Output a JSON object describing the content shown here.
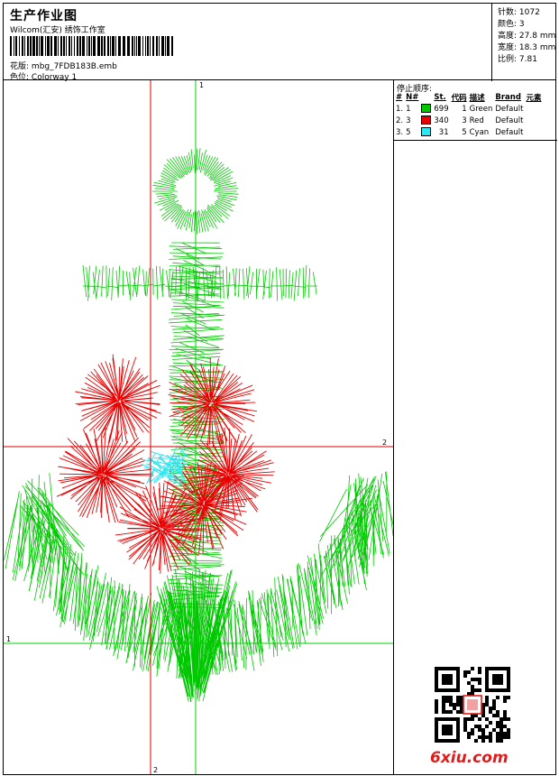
{
  "header": {
    "title": "生产作业图",
    "company": "Wilcom(汇安) 绣饰工作室",
    "design_label": "花版:",
    "design_value": "mbg_7FDB183B.emb",
    "colorway_label": "色位:",
    "colorway_value": "Colorway 1"
  },
  "specs": [
    {
      "label": "针数:",
      "value": "1072"
    },
    {
      "label": "颜色:",
      "value": "3"
    },
    {
      "label": "高度:",
      "value": "27.8 mm"
    },
    {
      "label": "宽度:",
      "value": "18.3 mm"
    },
    {
      "label": "比例:",
      "value": "7.81"
    }
  ],
  "stop_sequence": {
    "title": "停止顺序:",
    "columns": [
      "#",
      "N#",
      "St.",
      "代码",
      "描述",
      "Brand",
      "元素"
    ],
    "rows": [
      {
        "index": "1.",
        "needle": "1",
        "stitches": "699",
        "code": "1",
        "desc": "Green",
        "brand": "Default",
        "color": "#00c800"
      },
      {
        "index": "2.",
        "needle": "3",
        "stitches": "340",
        "code": "3",
        "desc": "Red",
        "brand": "Default",
        "color": "#e60000"
      },
      {
        "index": "3.",
        "needle": "5",
        "stitches": "31",
        "code": "5",
        "desc": "Cyan",
        "brand": "Default",
        "color": "#2ee6f0"
      }
    ]
  },
  "guides": {
    "v1_label": "1",
    "v2_label": "2",
    "h1_label": "1",
    "h2_label": "2",
    "green": "#00d000",
    "red": "#e00000"
  },
  "watermark": "6xiu.com"
}
